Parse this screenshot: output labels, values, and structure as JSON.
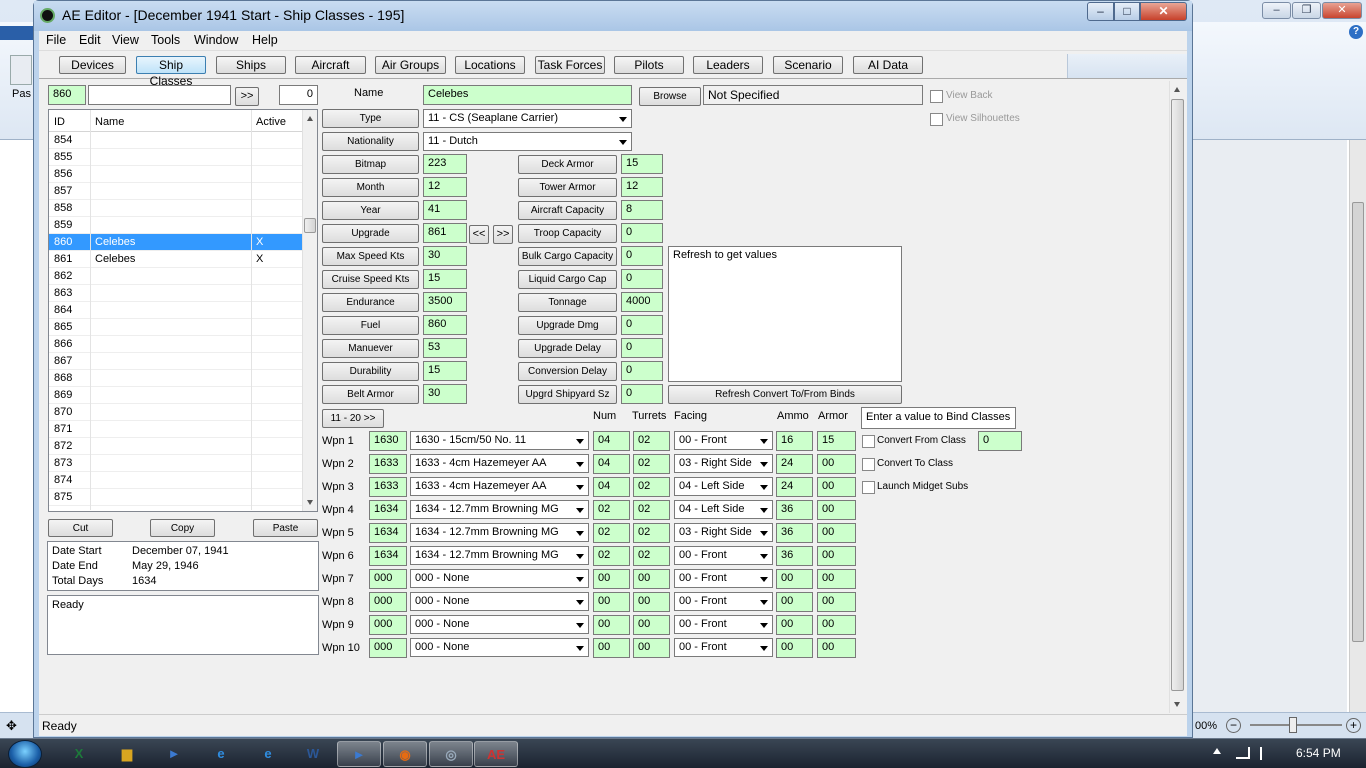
{
  "background_app": {
    "partial_label": "Pas",
    "zoom": "00%",
    "zoom_out": "−",
    "zoom_in": "+",
    "help": "?",
    "move_icon": "✥"
  },
  "window": {
    "title": "AE Editor - [December 1941 Start - Ship Classes - 195]"
  },
  "menu": [
    "File",
    "Edit",
    "View",
    "Tools",
    "Window",
    "Help"
  ],
  "tabs": [
    "Devices",
    "Ship Classes",
    "Ships",
    "Aircraft",
    "Air Groups",
    "Locations",
    "Task Forces",
    "Pilots",
    "Leaders",
    "Scenario",
    "AI Data"
  ],
  "active_tab": "Ship Classes",
  "search": {
    "id_value": "860",
    "text_value": "",
    "go_label": ">>",
    "count": "0"
  },
  "list": {
    "headers": {
      "id": "ID",
      "name": "Name",
      "active": "Active"
    },
    "rows": [
      {
        "id": "854",
        "name": "",
        "active": ""
      },
      {
        "id": "855",
        "name": "",
        "active": ""
      },
      {
        "id": "856",
        "name": "",
        "active": ""
      },
      {
        "id": "857",
        "name": "",
        "active": ""
      },
      {
        "id": "858",
        "name": "",
        "active": ""
      },
      {
        "id": "859",
        "name": "",
        "active": ""
      },
      {
        "id": "860",
        "name": "Celebes",
        "active": "X"
      },
      {
        "id": "861",
        "name": "Celebes",
        "active": "X"
      },
      {
        "id": "862",
        "name": "",
        "active": ""
      },
      {
        "id": "863",
        "name": "",
        "active": ""
      },
      {
        "id": "864",
        "name": "",
        "active": ""
      },
      {
        "id": "865",
        "name": "",
        "active": ""
      },
      {
        "id": "866",
        "name": "",
        "active": ""
      },
      {
        "id": "867",
        "name": "",
        "active": ""
      },
      {
        "id": "868",
        "name": "",
        "active": ""
      },
      {
        "id": "869",
        "name": "",
        "active": ""
      },
      {
        "id": "870",
        "name": "",
        "active": ""
      },
      {
        "id": "871",
        "name": "",
        "active": ""
      },
      {
        "id": "872",
        "name": "",
        "active": ""
      },
      {
        "id": "873",
        "name": "",
        "active": ""
      },
      {
        "id": "874",
        "name": "",
        "active": ""
      },
      {
        "id": "875",
        "name": "",
        "active": ""
      }
    ],
    "selected_id": "860"
  },
  "edit_buttons": {
    "cut": "Cut",
    "copy": "Copy",
    "paste": "Paste"
  },
  "dates": {
    "start_label": "Date Start",
    "start_value": "December 07, 1941",
    "end_label": "Date End",
    "end_value": "May 29, 1946",
    "days_label": "Total Days",
    "days_value": "1634"
  },
  "log_text": "Ready",
  "detail": {
    "name_label": "Name",
    "name_value": "Celebes",
    "browse_label": "Browse",
    "browse_value": "Not Specified",
    "view_back": "View Back",
    "view_silhouettes": "View Silhouettes",
    "type_label": "Type",
    "type_value": "11 - CS (Seaplane Carrier)",
    "nationality_label": "Nationality",
    "nationality_value": "11 - Dutch",
    "upgrade_prev": "<<",
    "upgrade_next": ">>",
    "left_fields": [
      {
        "label": "Bitmap",
        "value": "223"
      },
      {
        "label": "Month",
        "value": "12"
      },
      {
        "label": "Year",
        "value": "41"
      },
      {
        "label": "Upgrade",
        "value": "861"
      },
      {
        "label": "Max Speed Kts",
        "value": "30"
      },
      {
        "label": "Cruise Speed Kts",
        "value": "15"
      },
      {
        "label": "Endurance",
        "value": "3500"
      },
      {
        "label": "Fuel",
        "value": "860"
      },
      {
        "label": "Manuever",
        "value": "53"
      },
      {
        "label": "Durability",
        "value": "15"
      },
      {
        "label": "Belt Armor",
        "value": "30"
      }
    ],
    "right_fields": [
      {
        "label": "Deck Armor",
        "value": "15"
      },
      {
        "label": "Tower Armor",
        "value": "12"
      },
      {
        "label": "Aircraft Capacity",
        "value": "8"
      },
      {
        "label": "Troop Capacity",
        "value": "0"
      },
      {
        "label": "Bulk Cargo Capacity",
        "value": "0"
      },
      {
        "label": "Liquid Cargo Cap",
        "value": "0"
      },
      {
        "label": "Tonnage",
        "value": "4000"
      },
      {
        "label": "Upgrade Dmg",
        "value": "0"
      },
      {
        "label": "Upgrade Delay",
        "value": "0"
      },
      {
        "label": "Conversion Delay",
        "value": "0"
      },
      {
        "label": "Upgrd Shipyard Sz",
        "value": "0"
      }
    ],
    "binds_text": "Refresh to get values",
    "refresh_binds_label": "Refresh Convert To/From Binds"
  },
  "weapons": {
    "page_button": "11 - 20 >>",
    "headers": {
      "num": "Num",
      "turrets": "Turrets",
      "facing": "Facing",
      "ammo": "Ammo",
      "armor": "Armor"
    },
    "rows": [
      {
        "label": "Wpn 1",
        "id": "1630",
        "device": "1630 - 15cm/50 No. 11",
        "num": "04",
        "turrets": "02",
        "facing": "00 - Front",
        "ammo": "16",
        "armor": "15"
      },
      {
        "label": "Wpn 2",
        "id": "1633",
        "device": "1633 - 4cm Hazemeyer AA",
        "num": "04",
        "turrets": "02",
        "facing": "03 - Right Side",
        "ammo": "24",
        "armor": "00"
      },
      {
        "label": "Wpn 3",
        "id": "1633",
        "device": "1633 - 4cm Hazemeyer AA",
        "num": "04",
        "turrets": "02",
        "facing": "04 - Left Side",
        "ammo": "24",
        "armor": "00"
      },
      {
        "label": "Wpn 4",
        "id": "1634",
        "device": "1634 - 12.7mm Browning MG",
        "num": "02",
        "turrets": "02",
        "facing": "04 - Left Side",
        "ammo": "36",
        "armor": "00"
      },
      {
        "label": "Wpn 5",
        "id": "1634",
        "device": "1634 - 12.7mm Browning MG",
        "num": "02",
        "turrets": "02",
        "facing": "03 - Right Side",
        "ammo": "36",
        "armor": "00"
      },
      {
        "label": "Wpn 6",
        "id": "1634",
        "device": "1634 - 12.7mm Browning MG",
        "num": "02",
        "turrets": "02",
        "facing": "00 - Front",
        "ammo": "36",
        "armor": "00"
      },
      {
        "label": "Wpn 7",
        "id": "000",
        "device": "000 - None",
        "num": "00",
        "turrets": "00",
        "facing": "00 - Front",
        "ammo": "00",
        "armor": "00"
      },
      {
        "label": "Wpn 8",
        "id": "000",
        "device": "000 - None",
        "num": "00",
        "turrets": "00",
        "facing": "00 - Front",
        "ammo": "00",
        "armor": "00"
      },
      {
        "label": "Wpn 9",
        "id": "000",
        "device": "000 - None",
        "num": "00",
        "turrets": "00",
        "facing": "00 - Front",
        "ammo": "00",
        "armor": "00"
      },
      {
        "label": "Wpn 10",
        "id": "000",
        "device": "000 - None",
        "num": "00",
        "turrets": "00",
        "facing": "00 - Front",
        "ammo": "00",
        "armor": "00"
      }
    ]
  },
  "bind": {
    "header": "Enter a value to Bind Classes",
    "convert_from": "Convert From Class",
    "convert_from_value": "0",
    "convert_to": "Convert To Class",
    "midget_subs": "Launch Midget Subs"
  },
  "status": "Ready",
  "taskbar": {
    "icons": [
      {
        "name": "excel-icon",
        "glyph": "X",
        "color": "#1d7a3a"
      },
      {
        "name": "explorer-icon",
        "glyph": "▆",
        "color": "#d9a520"
      },
      {
        "name": "media-icon",
        "glyph": "►",
        "color": "#3b7ad1"
      },
      {
        "name": "ie-icon",
        "glyph": "e",
        "color": "#2f8de0"
      },
      {
        "name": "ie2-icon",
        "glyph": "e",
        "color": "#2f8de0"
      },
      {
        "name": "word-icon",
        "glyph": "W",
        "color": "#2b5797"
      },
      {
        "name": "media2-icon",
        "glyph": "►",
        "color": "#3b7ad1"
      },
      {
        "name": "firefox-icon",
        "glyph": "◉",
        "color": "#e66b12"
      },
      {
        "name": "app-icon",
        "glyph": "◎",
        "color": "#9ab"
      },
      {
        "name": "witp-ae-icon",
        "glyph": "AE",
        "color": "#c33"
      }
    ],
    "clock": "6:54 PM"
  }
}
